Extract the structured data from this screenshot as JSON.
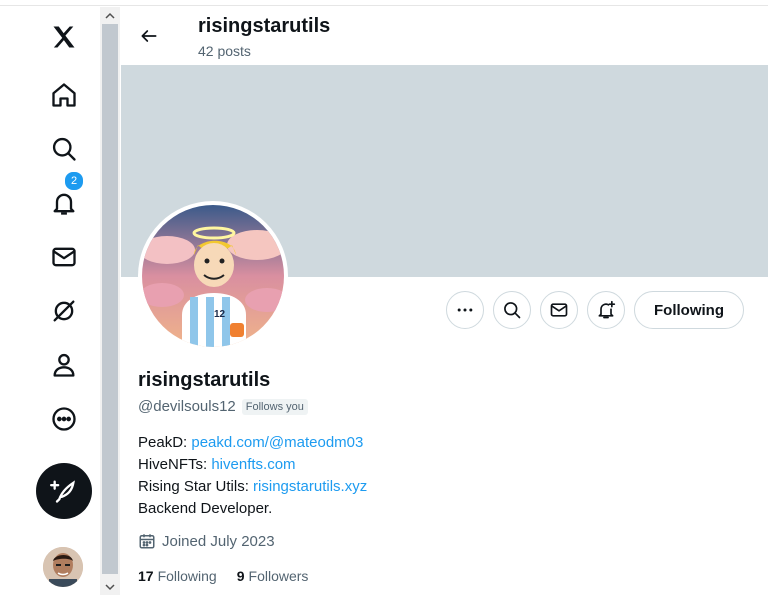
{
  "nav": {
    "notifications_badge": "2"
  },
  "header": {
    "name": "risingstarutils",
    "posts": "42 posts"
  },
  "actions": {
    "following_label": "Following"
  },
  "profile": {
    "display_name": "risingstarutils",
    "handle": "@devilsouls12",
    "follows_you": "Follows you",
    "bio": {
      "line1_prefix": "PeakD: ",
      "line1_link": "peakd.com/@mateodm03",
      "line2_prefix": "HiveNFTs: ",
      "line2_link": "hivenfts.com",
      "line3_prefix": "Rising Star Utils: ",
      "line3_link": "risingstarutils.xyz",
      "line4": "Backend Developer."
    },
    "joined": "Joined July 2023",
    "following_count": "17",
    "following_label": "Following",
    "followers_count": "9",
    "followers_label": "Followers"
  },
  "icons": {
    "logo": "x-logo-icon",
    "home": "home-icon",
    "search": "search-icon",
    "notifications": "bell-icon",
    "messages": "mail-icon",
    "grok": "grok-icon",
    "profile": "person-icon",
    "more": "more-circle-icon",
    "compose": "feather-plus-icon"
  },
  "colors": {
    "accent": "#1d9bf0",
    "banner": "#cfd9de",
    "text": "#0f1419",
    "secondary": "#536471"
  }
}
